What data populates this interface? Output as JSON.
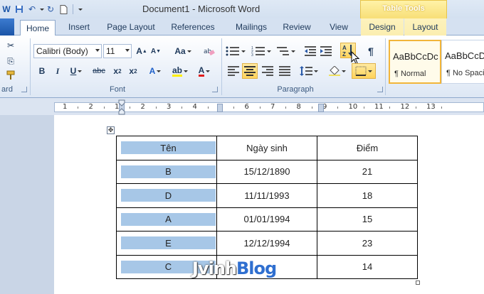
{
  "window": {
    "title": "Document1 - Microsoft Word"
  },
  "quick_access": {
    "undo_glyph": "↶",
    "redo_glyph": "↻"
  },
  "context_tab_group": {
    "label": "Table Tools"
  },
  "tabs": [
    {
      "label": "Home",
      "active": true
    },
    {
      "label": "Insert"
    },
    {
      "label": "Page Layout"
    },
    {
      "label": "References"
    },
    {
      "label": "Mailings"
    },
    {
      "label": "Review"
    },
    {
      "label": "View"
    },
    {
      "label": "Design",
      "contextual": true
    },
    {
      "label": "Layout",
      "contextual": true
    }
  ],
  "ribbon": {
    "clipboard_label": "ard",
    "font_group_label": "Font",
    "paragraph_group_label": "Paragraph",
    "font_name": "Calibri (Body)",
    "font_size": "11",
    "styles": [
      {
        "sample": "AaBbCcDc",
        "name": "¶ Normal",
        "selected": true
      },
      {
        "sample": "AaBbCcDc",
        "name": "¶ No Spaci..."
      }
    ]
  },
  "ruler": {
    "numbers": [
      "1",
      "2",
      "1",
      "2",
      "3",
      "4",
      "5",
      "6",
      "7",
      "8",
      "9",
      "10",
      "11",
      "12",
      "13"
    ]
  },
  "table": {
    "rows": [
      [
        "Tên",
        "Ngày sinh",
        "Điểm"
      ],
      [
        "B",
        "15/12/1890",
        "21"
      ],
      [
        "D",
        "11/11/1993",
        "18"
      ],
      [
        "A",
        "01/01/1994",
        "15"
      ],
      [
        "E",
        "12/12/1994",
        "23"
      ],
      [
        "C",
        "",
        "14"
      ]
    ]
  },
  "watermark": {
    "part1": "Jvinh",
    "part2": "Blog"
  }
}
